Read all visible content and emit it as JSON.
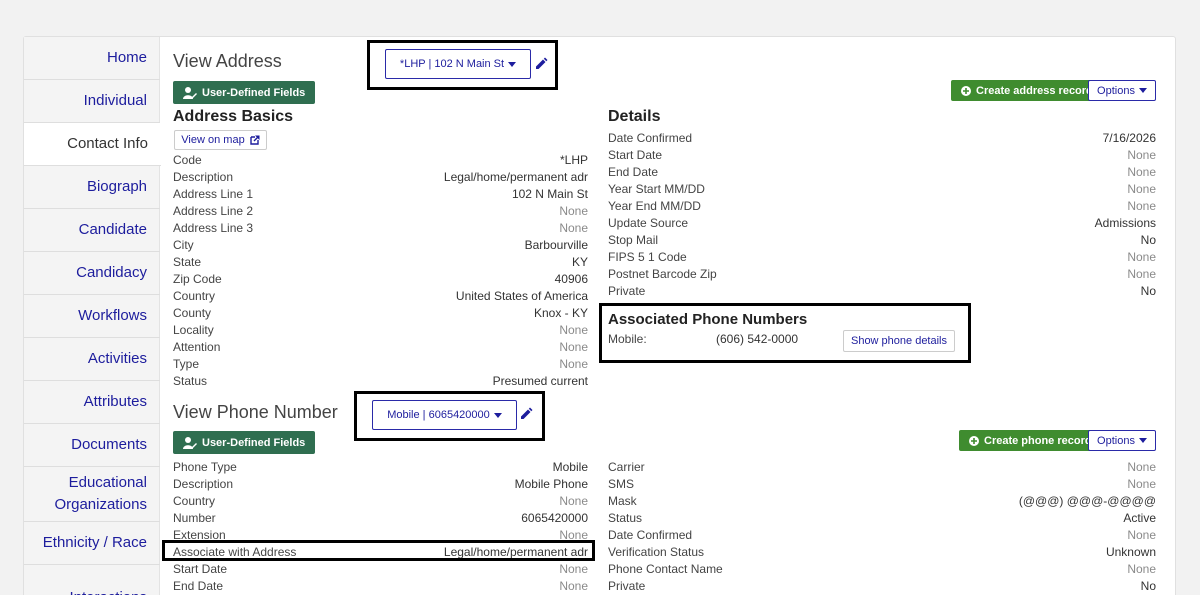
{
  "sidebar": {
    "items": [
      {
        "label": "Home"
      },
      {
        "label": "Individual"
      },
      {
        "label": "Contact Info"
      },
      {
        "label": "Biograph"
      },
      {
        "label": "Candidate"
      },
      {
        "label": "Candidacy"
      },
      {
        "label": "Workflows"
      },
      {
        "label": "Activities"
      },
      {
        "label": "Attributes"
      },
      {
        "label": "Documents"
      },
      {
        "label": "Educational Organizations"
      },
      {
        "label": "Ethnicity / Race"
      },
      {
        "label": "Interactions"
      }
    ],
    "active_index": 2
  },
  "address": {
    "view_title": "View Address",
    "selector_value": "*LHP | 102 N Main St",
    "udf_button": "User-Defined Fields",
    "create_button": "Create address record",
    "options_button": "Options",
    "basics_title": "Address Basics",
    "view_on_map": "View on map",
    "basics": [
      {
        "label": "Code",
        "value": "*LHP"
      },
      {
        "label": "Description",
        "value": "Legal/home/permanent adr"
      },
      {
        "label": "Address Line 1",
        "value": "102 N Main St"
      },
      {
        "label": "Address Line 2",
        "value": "None"
      },
      {
        "label": "Address Line 3",
        "value": "None"
      },
      {
        "label": "City",
        "value": "Barbourville"
      },
      {
        "label": "State",
        "value": "KY"
      },
      {
        "label": "Zip Code",
        "value": "40906"
      },
      {
        "label": "Country",
        "value": "United States of America"
      },
      {
        "label": "County",
        "value": "Knox - KY"
      },
      {
        "label": "Locality",
        "value": "None"
      },
      {
        "label": "Attention",
        "value": "None"
      },
      {
        "label": "Type",
        "value": "None"
      },
      {
        "label": "Status",
        "value": "Presumed current"
      }
    ],
    "details_title": "Details",
    "details": [
      {
        "label": "Date Confirmed",
        "value": "7/16/2026"
      },
      {
        "label": "Start Date",
        "value": "None"
      },
      {
        "label": "End Date",
        "value": "None"
      },
      {
        "label": "Year Start MM/DD",
        "value": "None"
      },
      {
        "label": "Year End MM/DD",
        "value": "None"
      },
      {
        "label": "Update Source",
        "value": "Admissions"
      },
      {
        "label": "Stop Mail",
        "value": "No"
      },
      {
        "label": "FIPS 5 1 Code",
        "value": "None"
      },
      {
        "label": "Postnet Barcode Zip",
        "value": "None"
      },
      {
        "label": "Private",
        "value": "No"
      }
    ],
    "phones_title": "Associated Phone Numbers",
    "phone_label": "Mobile:",
    "phone_value": "(606) 542-0000",
    "show_phone_details": "Show phone details"
  },
  "phone": {
    "view_title": "View Phone Number",
    "selector_value": "Mobile | 6065420000",
    "udf_button": "User-Defined Fields",
    "create_button": "Create phone record",
    "options_button": "Options",
    "left": [
      {
        "label": "Phone Type",
        "value": "Mobile"
      },
      {
        "label": "Description",
        "value": "Mobile Phone"
      },
      {
        "label": "Country",
        "value": "None"
      },
      {
        "label": "Number",
        "value": "6065420000"
      },
      {
        "label": "Extension",
        "value": "None"
      },
      {
        "label": "Associate with Address",
        "value": "Legal/home/permanent adr"
      },
      {
        "label": "Start Date",
        "value": "None"
      },
      {
        "label": "End Date",
        "value": "None"
      }
    ],
    "right": [
      {
        "label": "Carrier",
        "value": "None"
      },
      {
        "label": "SMS",
        "value": "None"
      },
      {
        "label": "Mask",
        "value": "(@@@) @@@-@@@@"
      },
      {
        "label": "Status",
        "value": "Active"
      },
      {
        "label": "Date Confirmed",
        "value": "None"
      },
      {
        "label": "Verification Status",
        "value": "Unknown"
      },
      {
        "label": "Phone Contact Name",
        "value": "None"
      },
      {
        "label": "Private",
        "value": "No"
      }
    ]
  },
  "colors": {
    "link": "#1d1d9d",
    "udf_button": "#2f6e50",
    "create_button": "#3f8c2f",
    "none_value": "#8a8a8a"
  },
  "icons": {
    "udf": "user-edit-icon",
    "edit": "pencil-icon",
    "create": "plus-circle-icon",
    "map": "external-link-icon",
    "dropdown": "caret-down-icon"
  }
}
